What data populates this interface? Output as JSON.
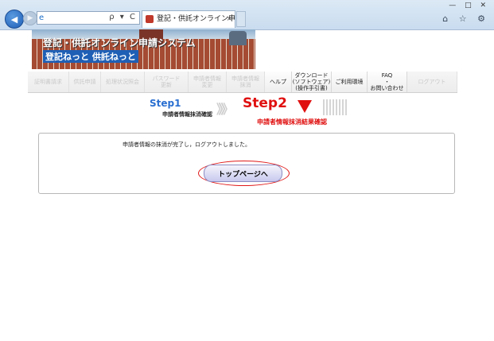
{
  "browser": {
    "address_text": "",
    "address_tools": "ρ ▾ C",
    "tab_title": "登記・供託オンライン申請シス...",
    "tab_close": "×",
    "window_controls": "— □ ✕",
    "tool_icons": "⌂ ☆ ⚙"
  },
  "site": {
    "title": "登記・供託オンライン申請システム",
    "subtitle": "登記ねっと 供託ねっと"
  },
  "menu": [
    {
      "label": "証明書請求",
      "enabled": false,
      "width": 52
    },
    {
      "label": "供託申請",
      "enabled": false,
      "width": 40
    },
    {
      "label": "処理状況照会",
      "enabled": false,
      "width": 55
    },
    {
      "label": "パスワード\n更新",
      "enabled": false,
      "width": 55
    },
    {
      "label": "申請者情報\n変更",
      "enabled": false,
      "width": 48
    },
    {
      "label": "申請者情報\n抹消",
      "enabled": false,
      "width": 48
    },
    {
      "label": "ヘルプ",
      "enabled": true,
      "width": 34
    },
    {
      "label": "ダウンロード\n(ソフトウェア)\n(操作手引書)",
      "enabled": true,
      "width": 50
    },
    {
      "label": "ご利用環境",
      "enabled": true,
      "width": 45
    },
    {
      "label": "FAQ\n・\nお問い合わせ",
      "enabled": true,
      "width": 50
    },
    {
      "label": "ログアウト",
      "enabled": false,
      "width": 63
    }
  ],
  "steps": {
    "step1_label": "Step1",
    "step1_caption": "申請者情報抹消確認",
    "chevrons": "》》》",
    "step2_label": "Step2",
    "step2_caption": "申請者情報抹消結果確認"
  },
  "content": {
    "message": "申請者情報の抹消が完了し，ログアウトしました。",
    "top_page_button": "トップページへ"
  }
}
